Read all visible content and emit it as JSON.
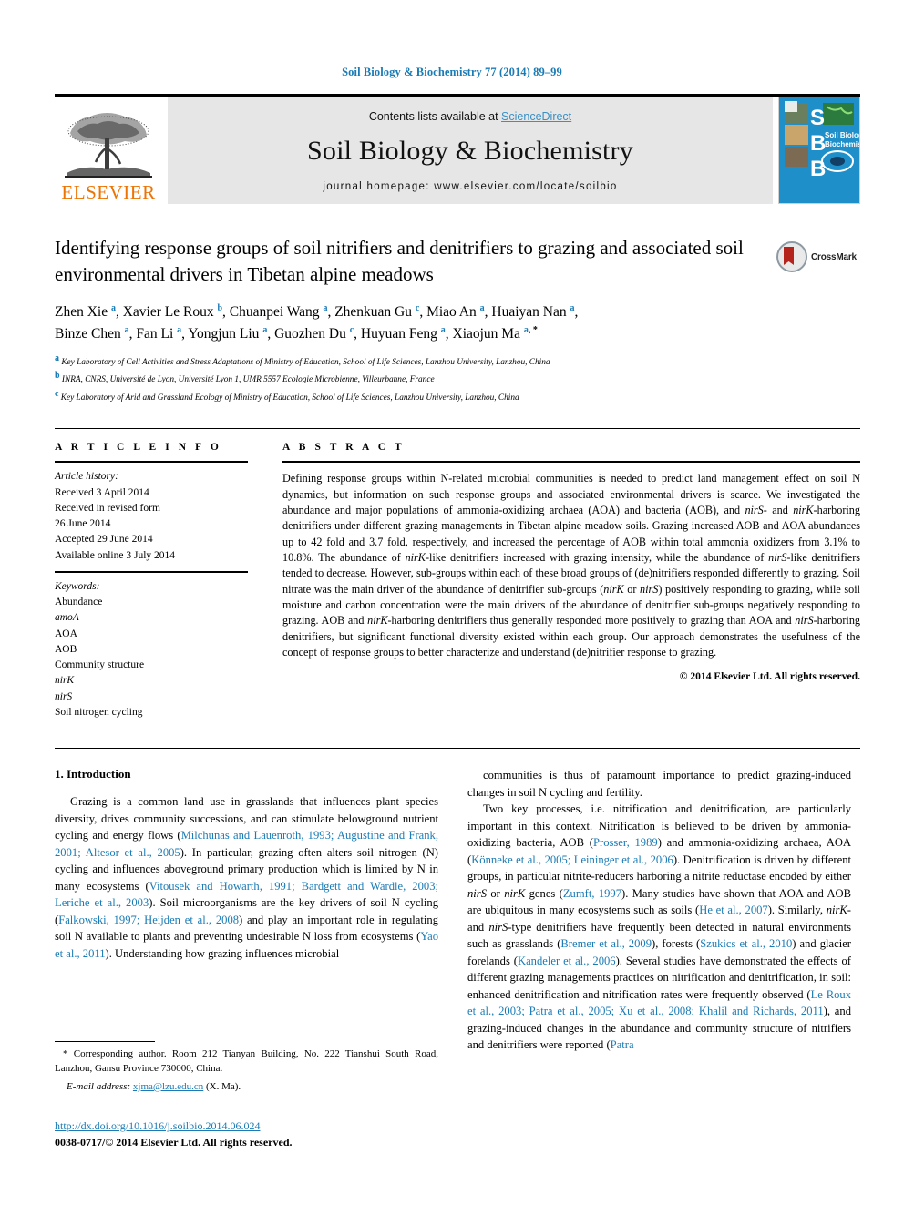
{
  "running_head": "Soil Biology & Biochemistry 77 (2014) 89–99",
  "masthead": {
    "publisher_logo_text": "ELSEVIER",
    "contents_prefix": "Contents lists available at ",
    "contents_link": "ScienceDirect",
    "journal_name": "Soil Biology & Biochemistry",
    "homepage_line": "journal homepage: www.elsevier.com/locate/soilbio",
    "cover_title_line1": "Soil Biology &",
    "cover_title_line2": "Biochemistry",
    "cover_letters": [
      "S",
      "B",
      "B"
    ]
  },
  "article": {
    "title": "Identifying response groups of soil nitrifiers and denitrifiers to grazing and associated soil environmental drivers in Tibetan alpine meadows",
    "crossmark_label": "CrossMark",
    "authors_line1": "Zhen Xie a, Xavier Le Roux b, Chuanpei Wang a, Zhenkuan Gu c, Miao An a, Huaiyan Nan a,",
    "authors_line2": "Binze Chen a, Fan Li a, Yongjun Liu a, Guozhen Du c, Huyuan Feng a, Xiaojun Ma a, *",
    "affiliations": [
      {
        "mark": "a",
        "text": "Key Laboratory of Cell Activities and Stress Adaptations of Ministry of Education, School of Life Sciences, Lanzhou University, Lanzhou, China"
      },
      {
        "mark": "b",
        "text": "INRA, CNRS, Université de Lyon, Université Lyon 1, UMR 5557 Ecologie Microbienne, Villeurbanne, France"
      },
      {
        "mark": "c",
        "text": "Key Laboratory of Arid and Grassland Ecology of Ministry of Education, School of Life Sciences, Lanzhou University, Lanzhou, China"
      }
    ]
  },
  "article_info": {
    "heading": "A R T I C L E  I N F O",
    "history_label": "Article history:",
    "history": [
      "Received 3 April 2014",
      "Received in revised form",
      "26 June 2014",
      "Accepted 29 June 2014",
      "Available online 3 July 2014"
    ],
    "keywords_label": "Keywords:",
    "keywords": [
      {
        "text": "Abundance",
        "italic": false
      },
      {
        "text": "amoA",
        "italic": true
      },
      {
        "text": "AOA",
        "italic": false
      },
      {
        "text": "AOB",
        "italic": false
      },
      {
        "text": "Community structure",
        "italic": false
      },
      {
        "text": "nirK",
        "italic": true
      },
      {
        "text": "nirS",
        "italic": true
      },
      {
        "text": "Soil nitrogen cycling",
        "italic": false
      }
    ]
  },
  "abstract": {
    "heading": "A B S T R A C T",
    "text_parts": [
      {
        "t": "Defining response groups within N-related microbial communities is needed to predict land management effect on soil N dynamics, but information on such response groups and associated environmental drivers is scarce. We investigated the abundance and major populations of ammonia-oxidizing archaea (AOA) and bacteria (AOB), and ",
        "i": false
      },
      {
        "t": "nirS",
        "i": true
      },
      {
        "t": "- and ",
        "i": false
      },
      {
        "t": "nirK",
        "i": true
      },
      {
        "t": "-harboring denitrifiers under different grazing managements in Tibetan alpine meadow soils. Grazing increased AOB and AOA abundances up to 42 fold and 3.7 fold, respectively, and increased the percentage of AOB within total ammonia oxidizers from 3.1% to 10.8%. The abundance of ",
        "i": false
      },
      {
        "t": "nirK",
        "i": true
      },
      {
        "t": "-like denitrifiers increased with grazing intensity, while the abundance of ",
        "i": false
      },
      {
        "t": "nirS",
        "i": true
      },
      {
        "t": "-like denitrifiers tended to decrease. However, sub-groups within each of these broad groups of (de)nitrifiers responded differently to grazing. Soil nitrate was the main driver of the abundance of denitrifier sub-groups (",
        "i": false
      },
      {
        "t": "nirK",
        "i": true
      },
      {
        "t": " or ",
        "i": false
      },
      {
        "t": "nirS",
        "i": true
      },
      {
        "t": ") positively responding to grazing, while soil moisture and carbon concentration were the main drivers of the abundance of denitrifier sub-groups negatively responding to grazing. AOB and ",
        "i": false
      },
      {
        "t": "nirK",
        "i": true
      },
      {
        "t": "-harboring denitrifiers thus generally responded more positively to grazing than AOA and ",
        "i": false
      },
      {
        "t": "nirS",
        "i": true
      },
      {
        "t": "-harboring denitrifiers, but significant functional diversity existed within each group. Our approach demonstrates the usefulness of the concept of response groups to better characterize and understand (de)nitrifier response to grazing.",
        "i": false
      }
    ],
    "copyright": "© 2014 Elsevier Ltd. All rights reserved."
  },
  "body": {
    "section_heading": "1. Introduction",
    "left_paragraphs": [
      [
        {
          "t": "Grazing is a common land use in grasslands that influences plant species diversity, drives community successions, and can stimulate belowground nutrient cycling and energy flows (",
          "k": "plain"
        },
        {
          "t": "Milchunas and Lauenroth, 1993; Augustine and Frank, 2001; Altesor et al., 2005",
          "k": "cite"
        },
        {
          "t": "). In particular, grazing often alters soil nitrogen (N) cycling and influences aboveground primary production which is limited by N in many ecosystems (",
          "k": "plain"
        },
        {
          "t": "Vitousek and Howarth, 1991; Bardgett and Wardle, 2003; Leriche et al., 2003",
          "k": "cite"
        },
        {
          "t": "). Soil microorganisms are the key drivers of soil N cycling (",
          "k": "plain"
        },
        {
          "t": "Falkowski, 1997; Heijden et al., 2008",
          "k": "cite"
        },
        {
          "t": ") and play an important role in regulating soil N available to plants and preventing undesirable N loss from ecosystems (",
          "k": "plain"
        },
        {
          "t": "Yao et al., 2011",
          "k": "cite"
        },
        {
          "t": "). Understanding how grazing influences microbial",
          "k": "plain"
        }
      ]
    ],
    "right_paragraphs": [
      [
        {
          "t": "communities is thus of paramount importance to predict grazing-induced changes in soil N cycling and fertility.",
          "k": "plain"
        }
      ],
      [
        {
          "t": "Two key processes, i.e. nitrification and denitrification, are particularly important in this context. Nitrification is believed to be driven by ammonia-oxidizing bacteria, AOB (",
          "k": "plain"
        },
        {
          "t": "Prosser, 1989",
          "k": "cite"
        },
        {
          "t": ") and ammonia-oxidizing archaea, AOA (",
          "k": "plain"
        },
        {
          "t": "Könneke et al., 2005; Leininger et al., 2006",
          "k": "cite"
        },
        {
          "t": "). Denitrification is driven by different groups, in particular nitrite-reducers harboring a nitrite reductase encoded by either ",
          "k": "plain"
        },
        {
          "t": "nirS",
          "k": "ital"
        },
        {
          "t": " or ",
          "k": "plain"
        },
        {
          "t": "nirK",
          "k": "ital"
        },
        {
          "t": " genes (",
          "k": "plain"
        },
        {
          "t": "Zumft, 1997",
          "k": "cite"
        },
        {
          "t": "). Many studies have shown that AOA and AOB are ubiquitous in many ecosystems such as soils (",
          "k": "plain"
        },
        {
          "t": "He et al., 2007",
          "k": "cite"
        },
        {
          "t": "). Similarly, ",
          "k": "plain"
        },
        {
          "t": "nirK",
          "k": "ital"
        },
        {
          "t": "- and ",
          "k": "plain"
        },
        {
          "t": "nirS",
          "k": "ital"
        },
        {
          "t": "-type denitrifiers have frequently been detected in natural environments such as grasslands (",
          "k": "plain"
        },
        {
          "t": "Bremer et al., 2009",
          "k": "cite"
        },
        {
          "t": "), forests (",
          "k": "plain"
        },
        {
          "t": "Szukics et al., 2010",
          "k": "cite"
        },
        {
          "t": ") and glacier forelands (",
          "k": "plain"
        },
        {
          "t": "Kandeler et al., 2006",
          "k": "cite"
        },
        {
          "t": "). Several studies have demonstrated the effects of different grazing managements practices on nitrification and denitrification, in soil: enhanced denitrification and nitrification rates were frequently observed (",
          "k": "plain"
        },
        {
          "t": "Le Roux et al., 2003; Patra et al., 2005; Xu et al., 2008; Khalil and Richards, 2011",
          "k": "cite"
        },
        {
          "t": "), and grazing-induced changes in the abundance and community structure of nitrifiers and denitrifiers were reported (",
          "k": "plain"
        },
        {
          "t": "Patra",
          "k": "cite"
        }
      ]
    ]
  },
  "footnote": {
    "star": "*",
    "text": "Corresponding author. Room 212 Tianyan Building, No. 222 Tianshui South Road, Lanzhou, Gansu Province 730000, China.",
    "email_label": "E-mail address:",
    "email": "xjma@lzu.edu.cn",
    "email_suffix": "(X. Ma)."
  },
  "footer": {
    "doi": "http://dx.doi.org/10.1016/j.soilbio.2014.06.024",
    "issn_line": "0038-0717/© 2014 Elsevier Ltd. All rights reserved."
  },
  "colors": {
    "link_blue": "#1a7bb5",
    "elsevier_orange": "#ec7404",
    "band_grey": "#e6e6e6",
    "cover_blue": "#1f8fc9",
    "crossmark_red": "#b5241c"
  }
}
